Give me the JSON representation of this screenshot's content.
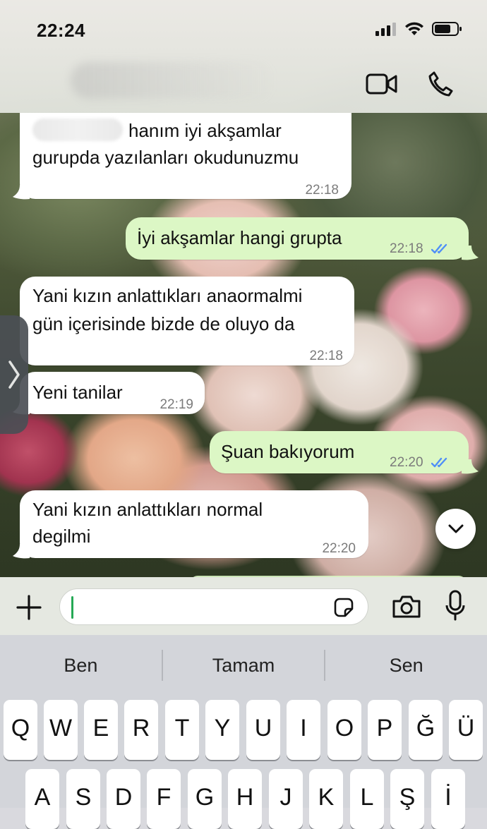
{
  "status_bar": {
    "time": "22:24"
  },
  "messages": [
    {
      "dir": "in",
      "lines": [
        "hanım iyi akşamlar",
        "gurupda yazılanları okudunuzmu"
      ],
      "time": "22:18"
    },
    {
      "dir": "out",
      "text": "İyi akşamlar hangi grupta",
      "time": "22:18",
      "status": "read"
    },
    {
      "dir": "in",
      "lines": [
        "Yani kızın anlattıkları anaormalmi",
        "gün içerisinde bizde de oluyo da"
      ],
      "time": "22:18"
    },
    {
      "dir": "in",
      "text": "Yeni tanilar",
      "time": "22:19"
    },
    {
      "dir": "out",
      "text": "Şuan bakıyorum",
      "time": "22:20",
      "status": "read"
    },
    {
      "dir": "in",
      "lines": [
        "Yani kızın anlattıkları normal",
        "degilmi"
      ],
      "time": "22:20"
    }
  ],
  "input": {
    "value": ""
  },
  "keyboard": {
    "suggestions": [
      "Ben",
      "Tamam",
      "Sen"
    ],
    "row1": [
      "Q",
      "W",
      "E",
      "R",
      "T",
      "Y",
      "U",
      "I",
      "O",
      "P",
      "Ğ",
      "Ü"
    ],
    "row2": [
      "A",
      "S",
      "D",
      "F",
      "G",
      "H",
      "J",
      "K",
      "L",
      "Ş",
      "İ"
    ]
  },
  "colors": {
    "outgoing_bubble": "#dcf7c5",
    "incoming_bubble": "#ffffff",
    "read_ticks": "#4f8ff7",
    "caret": "#25a955"
  }
}
